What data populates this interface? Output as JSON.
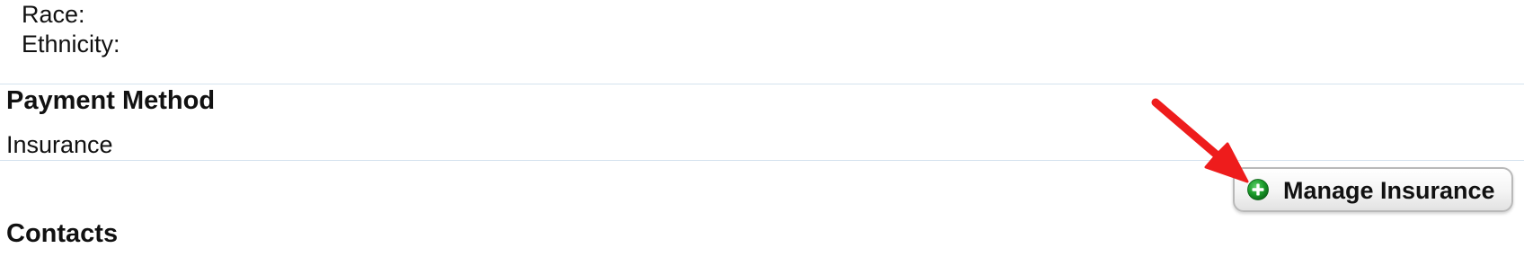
{
  "demographics": {
    "race_label": "Race:",
    "ethnicity_label": "Ethnicity:"
  },
  "payment_method": {
    "heading": "Payment Method",
    "value": "Insurance",
    "manage_button_label": "Manage Insurance",
    "manage_button_icon": "plus-circle-icon"
  },
  "contacts": {
    "heading": "Contacts"
  },
  "colors": {
    "divider": "#d4e2ee",
    "plus_icon_green": "#1a9a2a",
    "annotation_arrow": "#ee1c1c"
  }
}
